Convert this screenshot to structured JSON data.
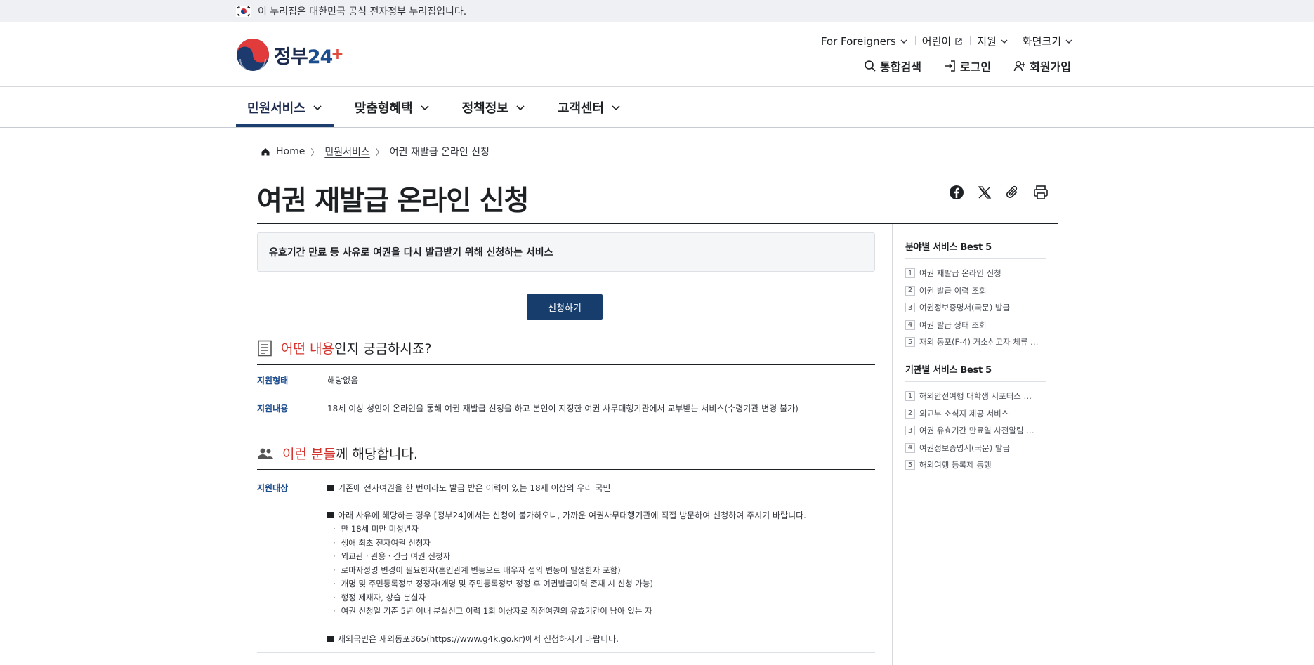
{
  "banner": {
    "text": "이 누리집은 대한민국 공식 전자정부 누리집입니다."
  },
  "logo": {
    "text_main": "정부",
    "text_num": "24",
    "text_plus": "+"
  },
  "util": {
    "foreigners": "For Foreigners",
    "kids": "어린이",
    "support": "지원",
    "screen_size": "화면크기"
  },
  "actions": {
    "search": "통합검색",
    "login": "로그인",
    "signup": "회원가입"
  },
  "gnb": [
    {
      "label": "민원서비스"
    },
    {
      "label": "맞춤형혜택"
    },
    {
      "label": "정책정보"
    },
    {
      "label": "고객센터"
    }
  ],
  "breadcrumb": {
    "home": "Home",
    "level1": "민원서비스",
    "current": "여권 재발급 온라인 신청"
  },
  "page": {
    "title": "여권 재발급 온라인 신청",
    "summary": "유효기간 만료 등 사유로 여권을 다시 발급받기 위해 신청하는 서비스",
    "apply_button": "신청하기"
  },
  "section1": {
    "heading_highlight": "어떤 내용",
    "heading_rest": "인지 궁금하시죠?",
    "rows": [
      {
        "label": "지원형태",
        "value": "해당없음"
      },
      {
        "label": "지원내용",
        "value": "18세 이상 성인이 온라인을 통해 여권 재발급 신청을 하고 본인이 지정한 여권 사무대행기관에서 교부받는 서비스(수령기관 변경 불가)"
      }
    ]
  },
  "section2": {
    "heading_highlight": "이런 분들",
    "heading_rest": "께 해당합니다.",
    "label": "지원대상",
    "item1": "기존에 전자여권을 한 번이라도 발급 받은 이력이 있는 18세 이상의 우리 국민",
    "item2": "아래 사유에 해당하는 경우 [정부24]에서는 신청이 불가하오니, 가까운 여권사무대행기관에 직접 방문하여 신청하여 주시기 바랍니다.",
    "subitems": [
      "만 18세 미만 미성년자",
      "생애 최초 전자여권 신청자",
      "외교관ㆍ관용ㆍ긴급 여권 신청자",
      "로마자성명 변경이 필요한자(혼인관계 변동으로 배우자 성의 변동이 발생한자 포함)",
      "개명 및 주민등록정보 정정자(개명 및 주민등록정보 정정 후 여권발급이력 존재 시 신청 가능)",
      "행정 제재자, 상습 분실자",
      "여권 신청일 기준 5년 이내 분실신고 이력 1회 이상자로 직전여권의 유효기간이 남아 있는 자"
    ],
    "item3": "재외국민은 재외동포365(https://www.g4k.go.kr)에서 신청하시기 바랍니다."
  },
  "sidebar": {
    "best_field": {
      "title": "분야별 서비스 Best 5",
      "items": [
        {
          "num": "1",
          "label": "여권 재발급 온라인 신청"
        },
        {
          "num": "2",
          "label": "여권 발급 이력 조회"
        },
        {
          "num": "3",
          "label": "여권정보증명서(국문) 발급"
        },
        {
          "num": "4",
          "label": "여권 발급 상태 조회"
        },
        {
          "num": "5",
          "label": "재외 동포(F-4) 거소신고자 체류 …"
        }
      ]
    },
    "best_org": {
      "title": "기관별 서비스 Best 5",
      "items": [
        {
          "num": "1",
          "label": "해외안전여행 대학생 서포터스 …"
        },
        {
          "num": "2",
          "label": "외교부 소식지 제공 서비스"
        },
        {
          "num": "3",
          "label": "여권 유효기간 만료일 사전알림 …"
        },
        {
          "num": "4",
          "label": "여권정보증명서(국문) 발급"
        },
        {
          "num": "5",
          "label": "해외여행 등록제 동행"
        }
      ]
    }
  },
  "colors": {
    "primary": "#163d6b",
    "highlight": "#d5352e",
    "label_blue": "#1c4d8f"
  }
}
